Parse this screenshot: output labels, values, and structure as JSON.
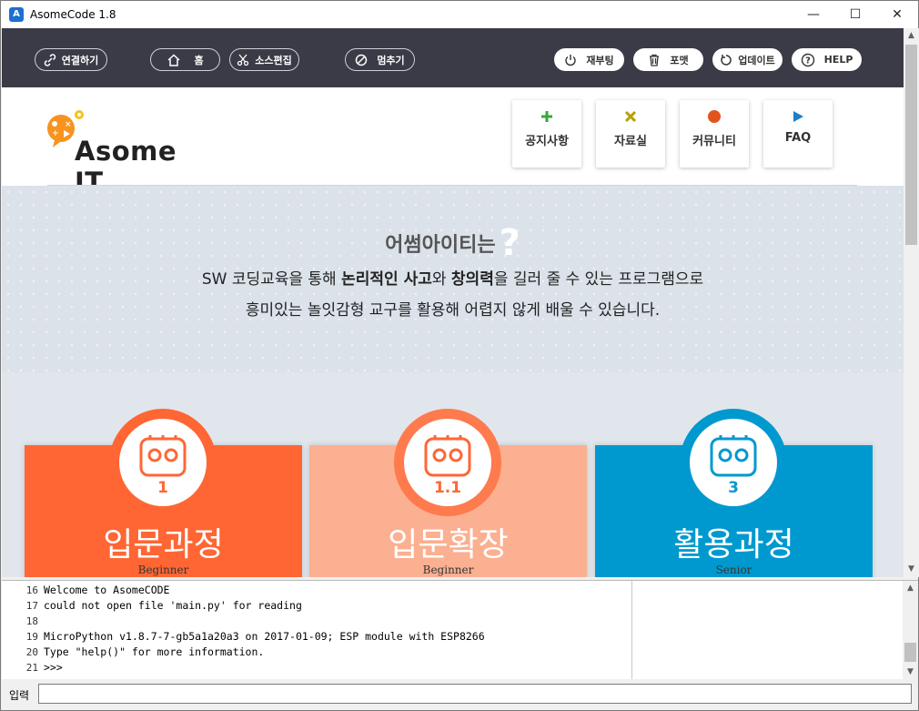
{
  "window": {
    "title": "AsomeCode 1.8",
    "controls": {
      "minimize": "—",
      "maximize": "☐",
      "close": "✕"
    }
  },
  "toolbar": {
    "connect": "연결하기",
    "home": "홈",
    "source_edit": "소스편집",
    "stop": "멈추기",
    "reboot": "재부팅",
    "format": "포맷",
    "update": "업데이트",
    "help": "HELP"
  },
  "header": {
    "logo_text": "Asome IT",
    "nav": [
      {
        "label": "공지사항",
        "icon": "plus-icon",
        "color": "#3aa63a"
      },
      {
        "label": "자료실",
        "icon": "x-icon",
        "color": "#b8a000"
      },
      {
        "label": "커뮤니티",
        "icon": "circle-icon",
        "color": "#e2541f"
      },
      {
        "label": "FAQ",
        "icon": "play-icon",
        "color": "#1d7fc7"
      }
    ]
  },
  "intro": {
    "title": "어썸아이티는",
    "title_mark": "?",
    "line1_a": "SW 코딩교육을 통해 ",
    "line1_b": "논리적인 사고",
    "line1_c": "와 ",
    "line1_d": "창의력",
    "line1_e": "을 길러 줄 수 있는 프로그램으로",
    "line2": "흥미있는 놀잇감형 교구를 활용해 어렵지 않게 배울 수 있습니다."
  },
  "courses": [
    {
      "name": "입문과정",
      "num": "1",
      "level": "Beginner",
      "color": "#ff6634",
      "num_color": "#ff6634"
    },
    {
      "name": "입문확장",
      "num": "1.1",
      "level": "Beginner",
      "color": "#fbb091",
      "num_color": "#ff6634"
    },
    {
      "name": "활용과정",
      "num": "3",
      "level": "Senior",
      "color": "#0099cf",
      "num_color": "#0099cf"
    }
  ],
  "console": {
    "lines": [
      {
        "no": "16",
        "text": "Welcome to AsomeCODE"
      },
      {
        "no": "17",
        "text": "could not open file 'main.py' for reading"
      },
      {
        "no": "18",
        "text": ""
      },
      {
        "no": "19",
        "text": "MicroPython v1.8.7-7-gb5a1a20a3 on 2017-01-09; ESP module with ESP8266"
      },
      {
        "no": "20",
        "text": "Type \"help()\" for more information."
      },
      {
        "no": "21",
        "text": ">>>"
      }
    ]
  },
  "input": {
    "label": "입력",
    "value": ""
  }
}
